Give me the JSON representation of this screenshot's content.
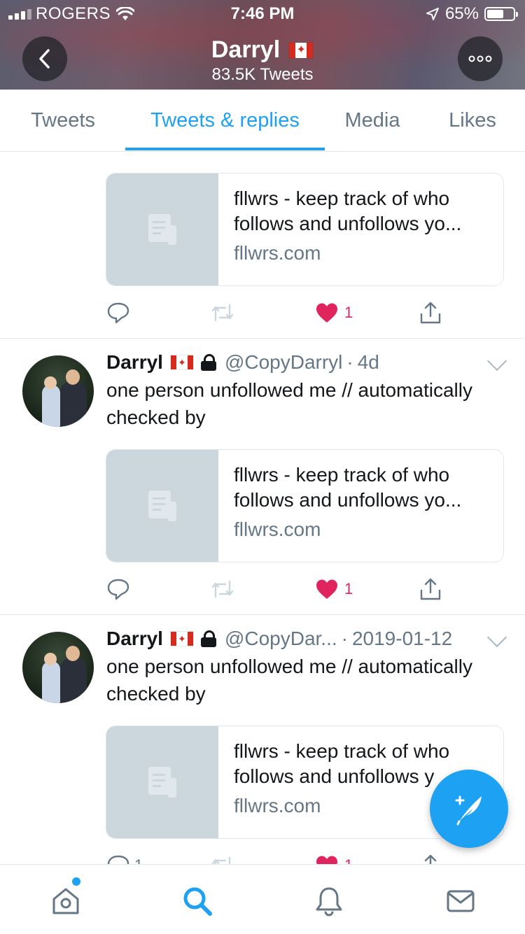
{
  "status_bar": {
    "carrier": "ROGERS",
    "time": "7:46 PM",
    "battery_text": "65%",
    "battery_level": 0.65
  },
  "header": {
    "name": "Darryl",
    "tweet_count": "83.5K Tweets",
    "back_icon": "chevron-left-icon",
    "more_icon": "ellipsis-icon"
  },
  "tabs": [
    {
      "label": "Tweets",
      "active": false
    },
    {
      "label": "Tweets & replies",
      "active": true
    },
    {
      "label": "Media",
      "active": false
    },
    {
      "label": "Likes",
      "active": false
    }
  ],
  "tweets": [
    {
      "card": {
        "title": "fllwrs - keep track of who follows and unfollows yo...",
        "domain": "fllwrs.com"
      },
      "likes": "1"
    },
    {
      "name": "Darryl",
      "handle": "@CopyDarryl",
      "time": "4d",
      "text": "one person unfollowed me // automatically checked by",
      "card": {
        "title": "fllwrs - keep track of who follows and unfollows yo...",
        "domain": "fllwrs.com"
      },
      "likes": "1"
    },
    {
      "name": "Darryl",
      "handle": "@CopyDar...",
      "time": "2019-01-12",
      "text": "one person unfollowed me // automatically checked by",
      "card": {
        "title": "fllwrs - keep track of who follows and unfollows y",
        "domain": "fllwrs.com"
      },
      "replies": "1",
      "likes": "1"
    }
  ],
  "separator": "·",
  "colors": {
    "accent": "#1da1f2",
    "like": "#e0245e",
    "muted": "#657786"
  },
  "bottom_nav": [
    "home-icon",
    "search-icon",
    "bell-icon",
    "mail-icon"
  ]
}
